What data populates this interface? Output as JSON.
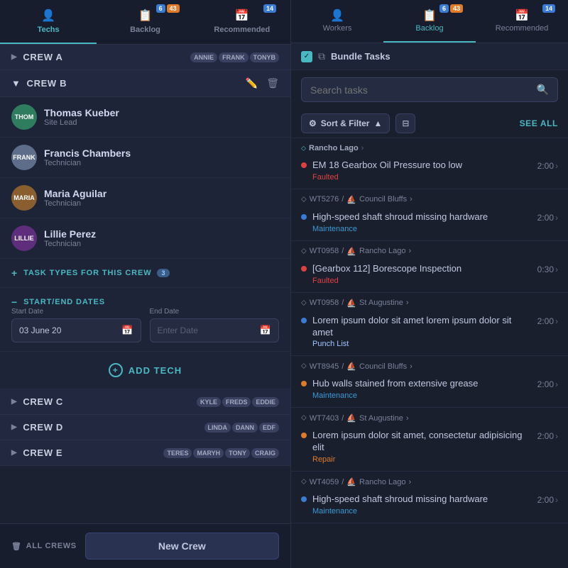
{
  "left": {
    "tabs": [
      {
        "label": "Techs",
        "icon": "👤",
        "active": true
      },
      {
        "label": "Backlog",
        "icon": "📋",
        "badge1": "6",
        "badge2": "43",
        "active": false
      },
      {
        "label": "Recommended",
        "icon": "📅",
        "badge1": "14",
        "active": false
      }
    ],
    "crews": [
      {
        "id": "crew-a",
        "label": "CREW A",
        "collapsed": true,
        "avatars": [
          "ANNIE",
          "FRANK",
          "TONYB"
        ]
      },
      {
        "id": "crew-b",
        "label": "CREW B",
        "collapsed": false,
        "members": [
          {
            "initials": "THOM",
            "name": "Thomas Kueber",
            "role": "Site Lead",
            "avatarClass": "avatar-thom"
          },
          {
            "initials": "FRANK",
            "name": "Francis Chambers",
            "role": "Technician",
            "avatarClass": "avatar-frank"
          },
          {
            "initials": "MARIA",
            "name": "Maria Aguilar",
            "role": "Technician",
            "avatarClass": "avatar-maria"
          },
          {
            "initials": "LILLIE",
            "name": "Lillie Perez",
            "role": "Technician",
            "avatarClass": "avatar-lillie"
          }
        ]
      },
      {
        "id": "crew-c",
        "label": "CREW C",
        "collapsed": true,
        "avatars": [
          "KYLE",
          "FREDS",
          "EDDIE"
        ]
      },
      {
        "id": "crew-d",
        "label": "CREW D",
        "collapsed": true,
        "avatars": [
          "LINDA",
          "DANN",
          "EDF"
        ]
      },
      {
        "id": "crew-e",
        "label": "CREW E",
        "collapsed": true,
        "avatars": [
          "TERES",
          "MARYH",
          "TONY",
          "CRAIG"
        ]
      }
    ],
    "task_types_label": "TASK TYPES FOR THIS CREW",
    "task_types_count": "3",
    "start_end_label": "START/END DATES",
    "start_date_label": "Start Date",
    "start_date_value": "03 June 20",
    "end_date_label": "End Date",
    "end_date_placeholder": "Enter Date",
    "add_tech_label": "ADD TECH",
    "all_crews_label": "ALL CREWS",
    "new_crew_label": "New Crew"
  },
  "right": {
    "tabs": [
      {
        "label": "Workers",
        "icon": "👤",
        "active": false
      },
      {
        "label": "Backlog",
        "icon": "📋",
        "badge1": "6",
        "badge2": "43",
        "active": true
      },
      {
        "label": "Recommended",
        "icon": "📅",
        "badge1": "14",
        "active": false
      }
    ],
    "bundle_label": "Bundle Tasks",
    "search_placeholder": "Search tasks",
    "filter_label": "Sort & Filter",
    "see_all_label": "SEE ALL",
    "tasks": [
      {
        "location": "Rancho Lago",
        "subtitle": "",
        "title": "EM 18 Gearbox Oil Pressure too low",
        "type": "Faulted",
        "type_class": "type-faulted",
        "dot_class": "dot-red",
        "time": "2:00"
      },
      {
        "location": "WT5276",
        "subloc": "Council Bluffs",
        "subtitle": "",
        "title": "High-speed shaft shroud missing hardware",
        "type": "Maintenance",
        "type_class": "type-maintenance",
        "dot_class": "dot-blue",
        "time": "2:00"
      },
      {
        "location": "WT0958",
        "subloc": "Rancho Lago",
        "subtitle": "",
        "title": "[Gearbox 112] Borescope Inspection",
        "type": "Faulted",
        "type_class": "type-faulted",
        "dot_class": "dot-red",
        "time": "0:30"
      },
      {
        "location": "WT0958",
        "subloc": "St Augustine",
        "subtitle": "",
        "title": "Lorem ipsum dolor sit amet lorem ipsum dolor sit amet",
        "type": "Punch List",
        "type_class": "type-punchlist",
        "dot_class": "dot-blue",
        "time": "2:00"
      },
      {
        "location": "WT8945",
        "subloc": "Council Bluffs",
        "subtitle": "",
        "title": "Hub walls stained from extensive grease",
        "type": "Maintenance",
        "type_class": "type-maintenance",
        "dot_class": "dot-orange",
        "time": "2:00"
      },
      {
        "location": "WT7403",
        "subloc": "St Augustine",
        "subtitle": "",
        "title": "Lorem ipsum dolor sit amet, consectetur adipisicing elit",
        "type": "Repair",
        "type_class": "type-repair",
        "dot_class": "dot-orange",
        "time": "2:00"
      },
      {
        "location": "WT4059",
        "subloc": "Rancho Lago",
        "subtitle": "",
        "title": "High-speed shaft shroud missing hardware",
        "type": "Maintenance",
        "type_class": "type-maintenance",
        "dot_class": "dot-blue",
        "time": "2:00"
      }
    ]
  }
}
